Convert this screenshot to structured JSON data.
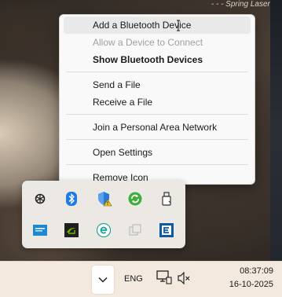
{
  "wallpaper": {
    "caption": "- - - Spring Laser ..."
  },
  "context_menu": {
    "items": [
      {
        "label": "Add a Bluetooth Device",
        "state": "hover"
      },
      {
        "label": "Allow a Device to Connect",
        "state": "disabled"
      },
      {
        "label": "Show Bluetooth Devices",
        "state": "bold"
      },
      {
        "label": "Send a File",
        "state": "normal"
      },
      {
        "label": "Receive a File",
        "state": "normal"
      },
      {
        "label": "Join a Personal Area Network",
        "state": "normal"
      },
      {
        "label": "Open Settings",
        "state": "normal"
      },
      {
        "label": "Remove Icon",
        "state": "normal"
      }
    ]
  },
  "tray_flyout": {
    "icons": [
      "chatgpt-icon",
      "bluetooth-icon",
      "security-warning-shield-icon",
      "sync-refresh-icon",
      "usb-drive-icon",
      "dell-monitor-app-icon",
      "nvidia-icon",
      "easy-connect-e-icon",
      "copy-windows-icon",
      "e-square-app-icon"
    ]
  },
  "taskbar": {
    "language": "ENG",
    "time": "08:37:09",
    "date": "16-10-2025",
    "icons": [
      "chevron-up-icon",
      "network-icon",
      "volume-muted-icon"
    ]
  },
  "colors": {
    "menu_bg": "#f9f9f9",
    "menu_hover": "#e9e9e9",
    "taskbar_bg": "#f3e9df",
    "bluetooth_blue": "#1f7be0"
  }
}
